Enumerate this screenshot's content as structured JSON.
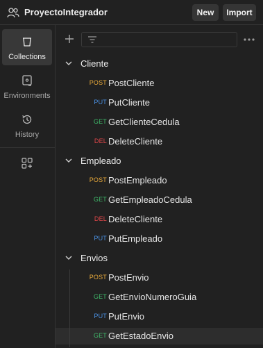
{
  "header": {
    "workspace_name": "ProyectoIntegrador",
    "new_label": "New",
    "import_label": "Import"
  },
  "sidebar": {
    "items": [
      {
        "label": "Collections",
        "icon": "collections-icon",
        "active": true
      },
      {
        "label": "Environments",
        "icon": "environments-icon",
        "active": false
      },
      {
        "label": "History",
        "icon": "history-icon",
        "active": false
      }
    ]
  },
  "colors": {
    "POST": "#e8a93a",
    "PUT": "#4a90e2",
    "GET": "#3fb96a",
    "DEL": "#e2474a"
  },
  "collections": [
    {
      "name": "Cliente",
      "requests": [
        {
          "method": "POST",
          "name": "PostCliente"
        },
        {
          "method": "PUT",
          "name": "PutCliente"
        },
        {
          "method": "GET",
          "name": "GetClienteCedula"
        },
        {
          "method": "DEL",
          "name": "DeleteCliente"
        }
      ]
    },
    {
      "name": "Empleado",
      "requests": [
        {
          "method": "POST",
          "name": "PostEmpleado"
        },
        {
          "method": "GET",
          "name": "GetEmpleadoCedula"
        },
        {
          "method": "DEL",
          "name": "DeleteCliente"
        },
        {
          "method": "PUT",
          "name": "PutEmpleado"
        }
      ]
    },
    {
      "name": "Envios",
      "requests": [
        {
          "method": "POST",
          "name": "PostEnvio"
        },
        {
          "method": "GET",
          "name": "GetEnvioNumeroGuia"
        },
        {
          "method": "PUT",
          "name": "PutEnvio"
        },
        {
          "method": "GET",
          "name": "GetEstadoEnvio",
          "active": true
        }
      ]
    }
  ]
}
